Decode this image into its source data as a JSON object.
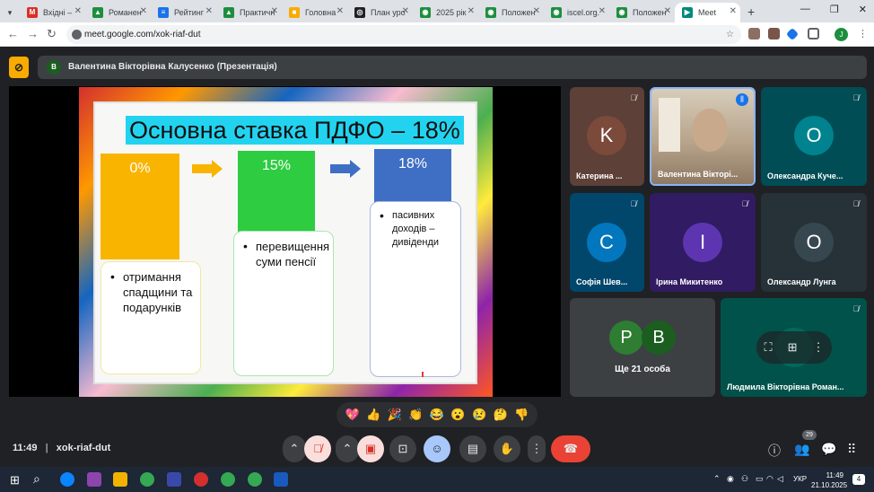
{
  "browser": {
    "tabs": [
      {
        "label": "Вхідні – ",
        "color": "#d93025",
        "glyph": "M"
      },
      {
        "label": "Романен",
        "color": "#1e8e3e",
        "glyph": "▲"
      },
      {
        "label": "Рейтинг",
        "color": "#1a73e8",
        "glyph": "≡"
      },
      {
        "label": "Практичн",
        "color": "#1e8e3e",
        "glyph": "▲"
      },
      {
        "label": "Головна",
        "color": "#f9ab00",
        "glyph": "■"
      },
      {
        "label": "План уро",
        "color": "#202124",
        "glyph": "◎"
      },
      {
        "label": "2025 рік",
        "color": "#1e8e3e",
        "glyph": "◉"
      },
      {
        "label": "Положен",
        "color": "#1e8e3e",
        "glyph": "◉"
      },
      {
        "label": "iscel.org.",
        "color": "#1e8e3e",
        "glyph": "◉"
      },
      {
        "label": "Положен",
        "color": "#1e8e3e",
        "glyph": "◉"
      },
      {
        "label": "Meet",
        "color": "#00897b",
        "glyph": "▶",
        "active": true
      }
    ],
    "url": "meet.google.com/xok-riaf-dut",
    "profile_initial": "J"
  },
  "meet": {
    "presenter_initial": "В",
    "presenter_banner": "Валентина Вікторівна Калусенко (Презентація)",
    "slide": {
      "title": "Основна ставка ПДФО – 18%",
      "steps": [
        {
          "label": "0%",
          "color": "#f9b400"
        },
        {
          "label": "15%",
          "color": "#2ecc40"
        },
        {
          "label": "18%",
          "color": "#3f6fc4"
        }
      ],
      "bullets": [
        "отримання спадщини та подарунків",
        "перевищення суми пенсії",
        "пасивних доходів – дивіденди"
      ]
    },
    "participants": [
      {
        "initial": "K",
        "name": "Катерина ...",
        "avatar_color": "#7b4a3b",
        "tile_color": "#5d4037"
      },
      {
        "initial": "",
        "name": "Валентина Вікторі...",
        "avatar_color": "#000",
        "tile_color": "#8d8173",
        "speaking": true
      },
      {
        "initial": "О",
        "name": "Олександра Куче...",
        "avatar_color": "#00838f",
        "tile_color": "#004d55"
      },
      {
        "initial": "С",
        "name": "Софія Шев...",
        "avatar_color": "#0277bd",
        "tile_color": "#01466b"
      },
      {
        "initial": "І",
        "name": "Ірина Микитенко",
        "avatar_color": "#5e35b1",
        "tile_color": "#311b62"
      },
      {
        "initial": "О",
        "name": "Олександр Лунга",
        "avatar_color": "#37474f",
        "tile_color": "#263238"
      },
      {
        "initial": "",
        "name": "Людмила Вікторівна Роман...",
        "avatar_color": "#00695c",
        "tile_color": "#00524a"
      }
    ],
    "more_people": {
      "initials": [
        "P",
        "B"
      ],
      "label": "Ще 21 особа"
    },
    "reactions": [
      "💖",
      "👍",
      "🎉",
      "👏",
      "😂",
      "😮",
      "😢",
      "🤔",
      "👎"
    ],
    "meeting_time": "11:49",
    "meeting_code": "xok-riaf-dut",
    "people_count": "29"
  },
  "system": {
    "time": "11:49",
    "date": "21.10.2025",
    "lang": "УКР",
    "notification_count": "4"
  }
}
